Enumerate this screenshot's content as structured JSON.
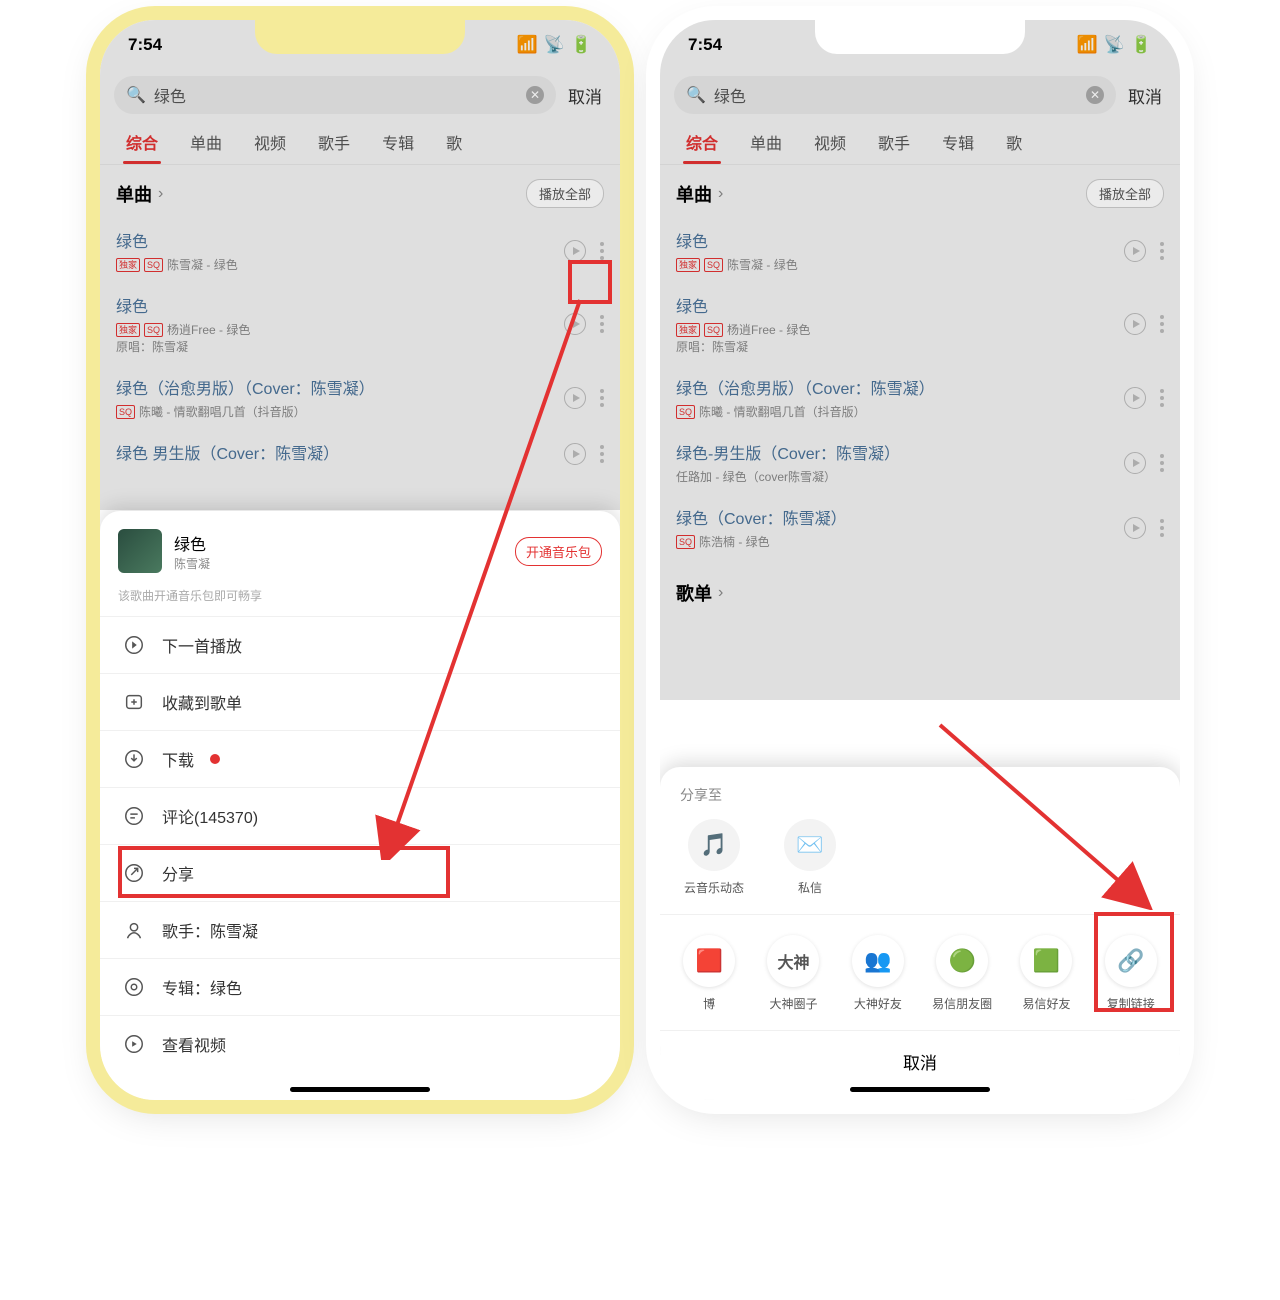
{
  "status": {
    "time": "7:54",
    "loc_glyph": "◁"
  },
  "search": {
    "query": "绿色",
    "cancel": "取消"
  },
  "tabs": [
    "综合",
    "单曲",
    "视频",
    "歌手",
    "专辑",
    "歌"
  ],
  "section": {
    "title": "单曲",
    "play_all": "播放全部"
  },
  "songs_left": [
    {
      "title": "绿色",
      "badges": [
        "独家",
        "SQ"
      ],
      "sub": "陈雪凝 - 绿色",
      "extra": ""
    },
    {
      "title": "绿色",
      "badges": [
        "独家",
        "SQ"
      ],
      "sub": "杨逍Free - 绿色",
      "extra": "原唱：陈雪凝"
    },
    {
      "title": "绿色（治愈男版）（Cover：陈雪凝）",
      "badges": [
        "SQ"
      ],
      "sub": "陈曦 - 情歌翻唱几首（抖音版）",
      "extra": ""
    },
    {
      "title": "绿色   男生版（Cover：陈雪凝）",
      "badges": [],
      "sub": "",
      "extra": ""
    }
  ],
  "songs_right": [
    {
      "title": "绿色",
      "badges": [
        "独家",
        "SQ"
      ],
      "sub": "陈雪凝 - 绿色",
      "extra": ""
    },
    {
      "title": "绿色",
      "badges": [
        "独家",
        "SQ"
      ],
      "sub": "杨逍Free - 绿色",
      "extra": "原唱：陈雪凝"
    },
    {
      "title": "绿色（治愈男版）（Cover：陈雪凝）",
      "badges": [
        "SQ"
      ],
      "sub": "陈曦 - 情歌翻唱几首（抖音版）",
      "extra": ""
    },
    {
      "title": "绿色-男生版（Cover：陈雪凝）",
      "badges": [],
      "sub": "任路加 - 绿色（cover陈雪凝）",
      "extra": ""
    },
    {
      "title": "绿色（Cover：陈雪凝）",
      "badges": [
        "SQ"
      ],
      "sub": "陈浩楠 - 绿色",
      "extra": ""
    }
  ],
  "playlist_section": "歌单",
  "song_sheet": {
    "name": "绿色",
    "artist": "陈雪凝",
    "pill": "开通音乐包",
    "hint": "该歌曲开通音乐包即可畅享",
    "items": [
      {
        "label": "下一首播放",
        "icon": "play-next"
      },
      {
        "label": "收藏到歌单",
        "icon": "add-playlist"
      },
      {
        "label": "下载",
        "icon": "download",
        "dot": true
      },
      {
        "label": "评论(145370)",
        "icon": "comment"
      },
      {
        "label": "分享",
        "icon": "share",
        "highlight": true
      },
      {
        "label": "歌手：陈雪凝",
        "icon": "artist"
      },
      {
        "label": "专辑：绿色",
        "icon": "album"
      },
      {
        "label": "查看视频",
        "icon": "video"
      }
    ]
  },
  "share": {
    "title": "分享至",
    "row1": [
      {
        "l": "云音乐动态"
      },
      {
        "l": "私信"
      }
    ],
    "row2": [
      {
        "l": "博"
      },
      {
        "l": "大神圈子"
      },
      {
        "l": "大神好友"
      },
      {
        "l": "易信朋友圈"
      },
      {
        "l": "易信好友"
      },
      {
        "l": "复制链接",
        "hl": true
      }
    ],
    "cancel": "取消"
  }
}
